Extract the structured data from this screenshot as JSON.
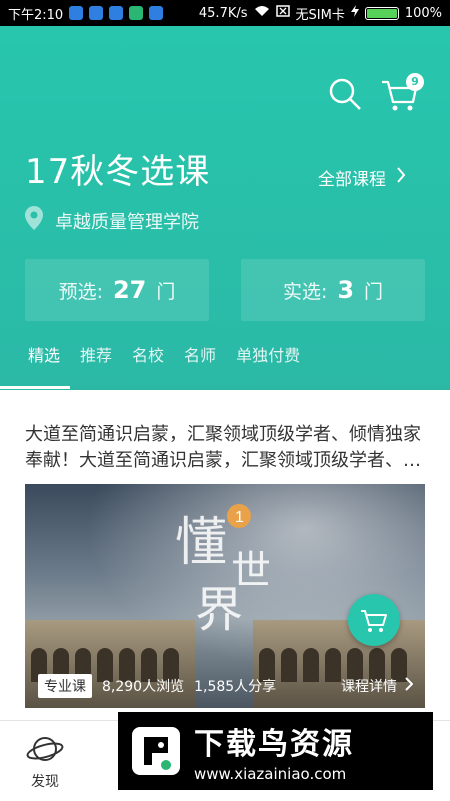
{
  "statusbar": {
    "time": "下午2:10",
    "speed": "45.7K/s",
    "sim": "无SIM卡",
    "battery": "100%"
  },
  "header": {
    "cart_count": "9",
    "title": "17秋冬选课",
    "all_courses_label": "全部课程",
    "location": "卓越质量管理学院",
    "preselect_label": "预选:",
    "preselect_count": "27",
    "preselect_unit": "门",
    "selected_label": "实选:",
    "selected_count": "3",
    "selected_unit": "门"
  },
  "tabs": [
    "精选",
    "推荐",
    "名校",
    "名师",
    "单独付费"
  ],
  "content": {
    "description": "大道至简通识启蒙，汇聚领域顶级学者、倾情独家奉献！大道至简通识启蒙，汇聚领域顶级学者、倾情独家奉献",
    "course": {
      "tag": "专业课",
      "views": "8,290人浏览",
      "shares": "1,585人分享",
      "detail_label": "课程详情"
    }
  },
  "bottom_nav": {
    "discover": "发现"
  },
  "watermark": {
    "main": "下载鸟资源",
    "url": "www.xiazainiao.com"
  },
  "colors": {
    "accent": "#27c6ad"
  }
}
